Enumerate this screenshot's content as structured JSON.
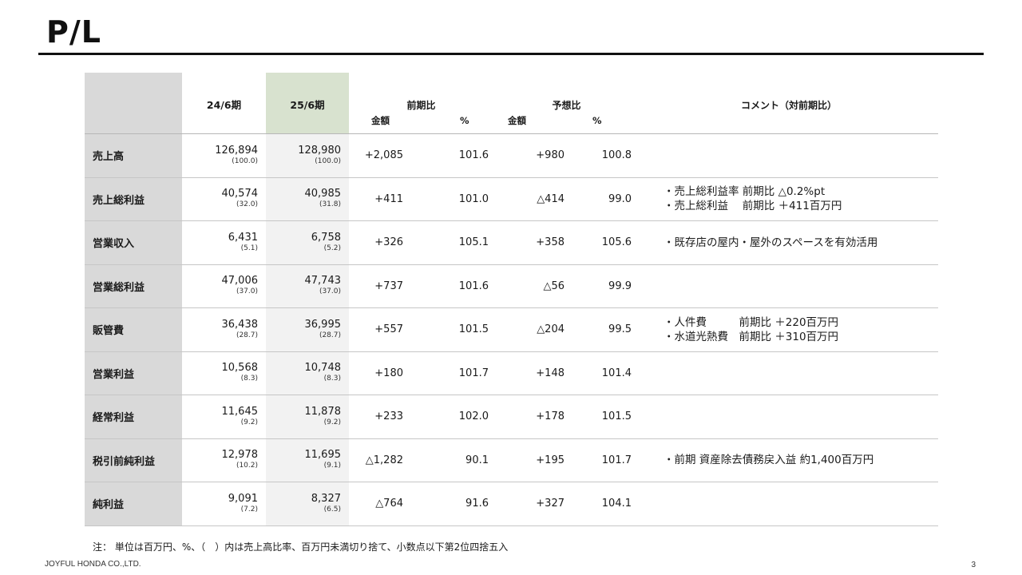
{
  "title": "P/L",
  "header": {
    "prev_period": "24/6期",
    "cur_period": "25/6期",
    "yoy_group": "前期比",
    "fcst_group": "予想比",
    "comment_group": "コメント（対前期比）",
    "amount": "金額",
    "pct": "%"
  },
  "rows": [
    {
      "label": "売上高",
      "prev": "126,894",
      "prev_ratio": "(100.0)",
      "cur": "128,980",
      "cur_ratio": "(100.0)",
      "yoy_amt": "+2,085",
      "yoy_pct": "101.6",
      "fc_amt": "+980",
      "fc_pct": "100.8",
      "comment": [
        "",
        ""
      ]
    },
    {
      "label": "売上総利益",
      "prev": "40,574",
      "prev_ratio": "(32.0)",
      "cur": "40,985",
      "cur_ratio": "(31.8)",
      "yoy_amt": "+411",
      "yoy_pct": "101.0",
      "fc_amt": "△414",
      "fc_pct": "99.0",
      "comment": [
        "・売上総利益率 前期比 △0.2%pt",
        "・売上総利益　 前期比 ＋411百万円"
      ]
    },
    {
      "label": "営業収入",
      "prev": "6,431",
      "prev_ratio": "(5.1)",
      "cur": "6,758",
      "cur_ratio": "(5.2)",
      "yoy_amt": "+326",
      "yoy_pct": "105.1",
      "fc_amt": "+358",
      "fc_pct": "105.6",
      "comment": [
        "・既存店の屋内・屋外のスペースを有効活用",
        ""
      ]
    },
    {
      "label": "営業総利益",
      "prev": "47,006",
      "prev_ratio": "(37.0)",
      "cur": "47,743",
      "cur_ratio": "(37.0)",
      "yoy_amt": "+737",
      "yoy_pct": "101.6",
      "fc_amt": "△56",
      "fc_pct": "99.9",
      "comment": [
        "",
        ""
      ]
    },
    {
      "label": "販管費",
      "prev": "36,438",
      "prev_ratio": "(28.7)",
      "cur": "36,995",
      "cur_ratio": "(28.7)",
      "yoy_amt": "+557",
      "yoy_pct": "101.5",
      "fc_amt": "△204",
      "fc_pct": "99.5",
      "comment": [
        "・人件費　　　前期比 ＋220百万円",
        "・水道光熱費　前期比 ＋310百万円"
      ]
    },
    {
      "label": "営業利益",
      "prev": "10,568",
      "prev_ratio": "(8.3)",
      "cur": "10,748",
      "cur_ratio": "(8.3)",
      "yoy_amt": "+180",
      "yoy_pct": "101.7",
      "fc_amt": "+148",
      "fc_pct": "101.4",
      "comment": [
        "",
        ""
      ]
    },
    {
      "label": "経常利益",
      "prev": "11,645",
      "prev_ratio": "(9.2)",
      "cur": "11,878",
      "cur_ratio": "(9.2)",
      "yoy_amt": "+233",
      "yoy_pct": "102.0",
      "fc_amt": "+178",
      "fc_pct": "101.5",
      "comment": [
        "",
        ""
      ]
    },
    {
      "label": "税引前純利益",
      "prev": "12,978",
      "prev_ratio": "(10.2)",
      "cur": "11,695",
      "cur_ratio": "(9.1)",
      "yoy_amt": "△1,282",
      "yoy_pct": "90.1",
      "fc_amt": "+195",
      "fc_pct": "101.7",
      "comment": [
        "・前期 資産除去債務戻入益 約1,400百万円",
        ""
      ]
    },
    {
      "label": "純利益",
      "prev": "9,091",
      "prev_ratio": "(7.2)",
      "cur": "8,327",
      "cur_ratio": "(6.5)",
      "yoy_amt": "△764",
      "yoy_pct": "91.6",
      "fc_amt": "+327",
      "fc_pct": "104.1",
      "comment": [
        "",
        ""
      ]
    }
  ],
  "note": "注：  単位は百万円、%、（　）内は売上高比率、百万円未満切り捨て、小数点以下第2位四捨五入",
  "footer": "JOYFUL HONDA CO.,LTD.",
  "page_number": "3"
}
